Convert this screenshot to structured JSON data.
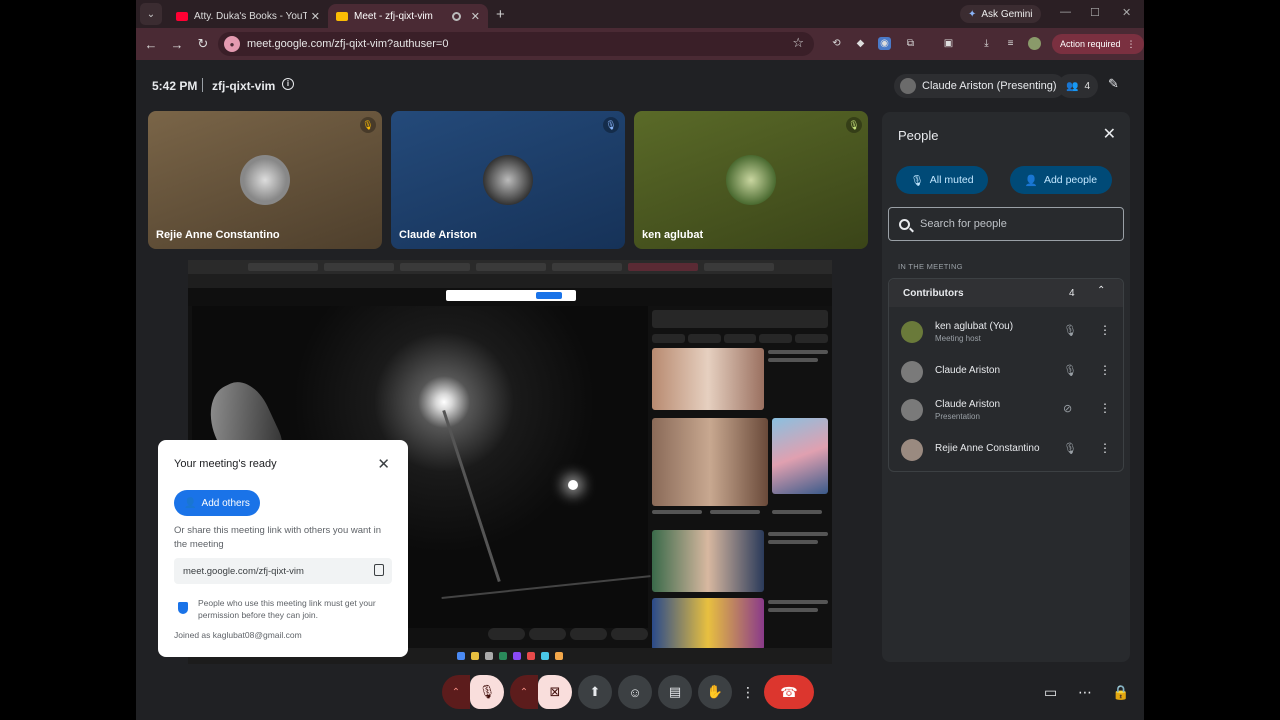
{
  "browser": {
    "tabs": [
      {
        "title": "Atty. Duka's Books - YouTube",
        "fav_color": "#ff0033"
      },
      {
        "title": "Meet - zfj-qixt-vim",
        "fav_color": "#fbbc04"
      }
    ],
    "ask_gemini": "Ask Gemini",
    "url": "meet.google.com/zfj-qixt-vim?authuser=0",
    "action_required": "Action required"
  },
  "meet": {
    "time": "5:42 PM",
    "meeting_code": "zfj-qixt-vim",
    "presenting_label": "Claude Ariston (Presenting)",
    "participant_count": "4",
    "tiles": [
      {
        "name": "Rejie Anne Constantino",
        "bg": "#6b5840"
      },
      {
        "name": "Claude Ariston",
        "bg": "#1f3b63"
      },
      {
        "name": "ken aglubat",
        "bg": "#4a5a22"
      }
    ]
  },
  "ready_popup": {
    "title": "Your meeting's ready",
    "add_others": "Add others",
    "description": "Or share this meeting link with others you want in the meeting",
    "link": "meet.google.com/zfj-qixt-vim",
    "note": "People who use this meeting link must get your permission before they can join.",
    "joined_as": "Joined as kaglubat08@gmail.com"
  },
  "people_panel": {
    "title": "People",
    "all_muted": "All muted",
    "add_people": "Add people",
    "search_placeholder": "Search for people",
    "section_label": "IN THE MEETING",
    "group_label": "Contributors",
    "group_count": "4",
    "people": [
      {
        "name": "ken aglubat (You)",
        "role": "Meeting host",
        "avatar": "#6a7a3a"
      },
      {
        "name": "Claude Ariston",
        "role": "",
        "avatar": "#7a7a7a"
      },
      {
        "name": "Claude Ariston",
        "role": "Presentation",
        "avatar": "#7a7a7a"
      },
      {
        "name": "Rejie Anne Constantino",
        "role": "",
        "avatar": "#9a8a80"
      }
    ]
  }
}
